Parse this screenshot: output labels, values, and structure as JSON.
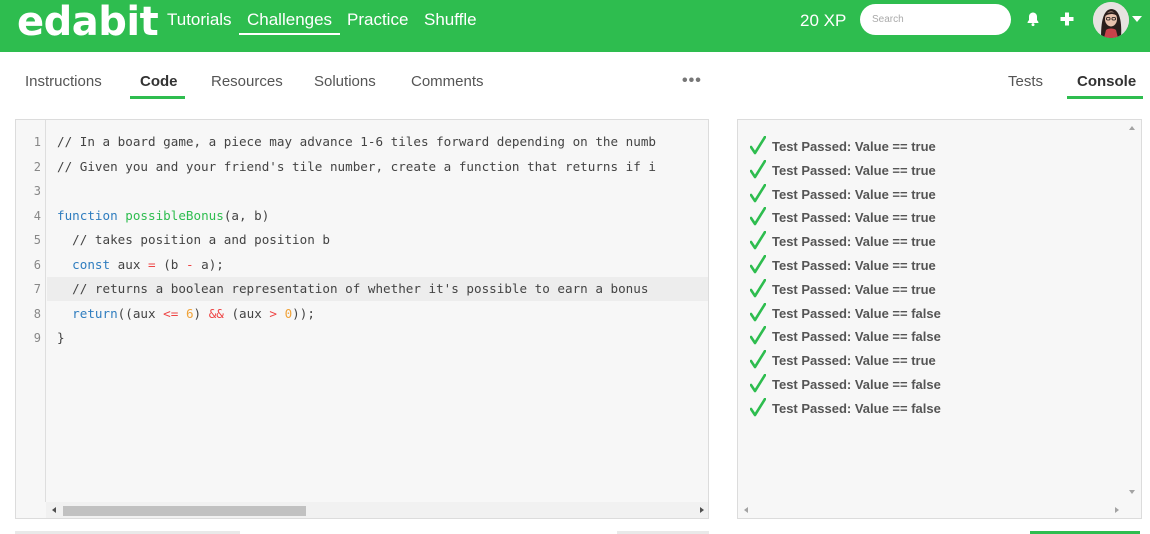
{
  "brand": {
    "logo": "edabit",
    "color": "#2ebd4f"
  },
  "nav": {
    "links": [
      "Tutorials",
      "Challenges",
      "Practice",
      "Shuffle"
    ],
    "active": "Challenges",
    "xp": "20 XP",
    "search_placeholder": "Search"
  },
  "tabs": {
    "left": [
      "Instructions",
      "Code",
      "Resources",
      "Solutions",
      "Comments"
    ],
    "left_active": "Code",
    "more": "•••",
    "right": [
      "Tests",
      "Console"
    ],
    "right_active": "Console"
  },
  "editor": {
    "line_numbers": [
      "1",
      "2",
      "3",
      "4",
      "5",
      "6",
      "7",
      "8",
      "9"
    ],
    "lines": [
      "// In a board game, a piece may advance 1-6 tiles forward depending on the numb",
      "// Given you and your friend's tile number, create a function that returns if i",
      "",
      "function possibleBonus(a, b)",
      "  // takes position a and position b",
      "  const aux = (b - a);",
      "  // returns a boolean representation of whether it's possible to earn a bonus",
      "  return((aux <= 6) && (aux > 0));",
      "}"
    ],
    "current_line": "7"
  },
  "console": {
    "results": [
      "Test Passed: Value == true",
      "Test Passed: Value == true",
      "Test Passed: Value == true",
      "Test Passed: Value == true",
      "Test Passed: Value == true",
      "Test Passed: Value == true",
      "Test Passed: Value == true",
      "Test Passed: Value == false",
      "Test Passed: Value == false",
      "Test Passed: Value == true",
      "Test Passed: Value == false",
      "Test Passed: Value == false"
    ],
    "pass_color": "#2ebd4f"
  }
}
